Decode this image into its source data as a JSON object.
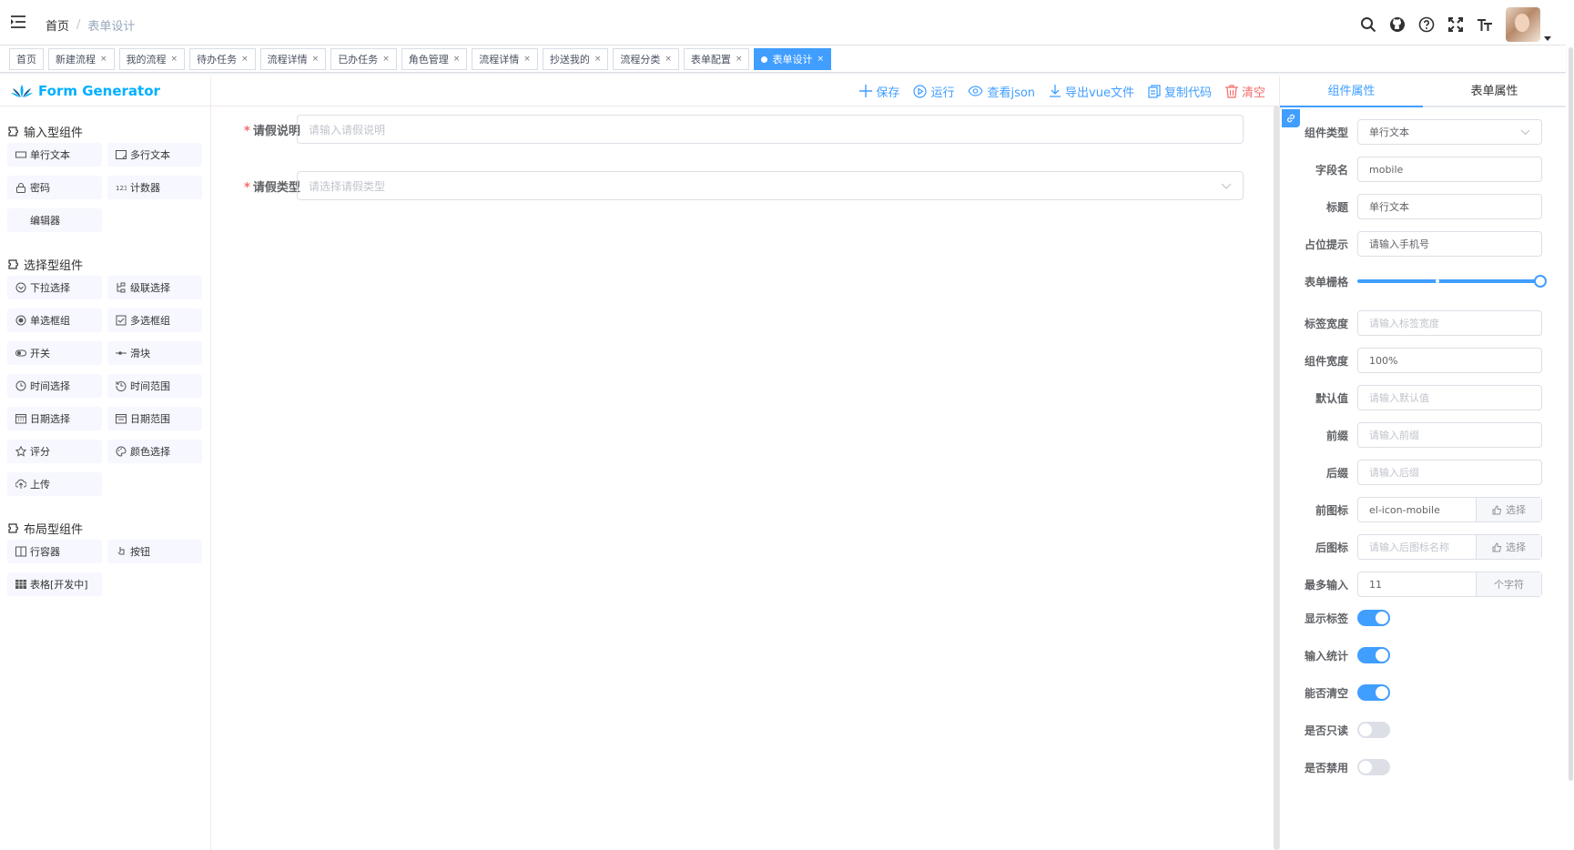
{
  "breadcrumb": {
    "home": "首页",
    "separator": "/",
    "current": "表单设计"
  },
  "tags": [
    {
      "label": "首页",
      "closable": false
    },
    {
      "label": "新建流程",
      "closable": true
    },
    {
      "label": "我的流程",
      "closable": true
    },
    {
      "label": "待办任务",
      "closable": true
    },
    {
      "label": "流程详情",
      "closable": true
    },
    {
      "label": "已办任务",
      "closable": true
    },
    {
      "label": "角色管理",
      "closable": true
    },
    {
      "label": "流程详情",
      "closable": true
    },
    {
      "label": "抄送我的",
      "closable": true
    },
    {
      "label": "流程分类",
      "closable": true
    },
    {
      "label": "表单配置",
      "closable": true
    },
    {
      "label": "表单设计",
      "closable": true,
      "active": true
    }
  ],
  "tag_close": "×",
  "logo": {
    "text": "Form Generator"
  },
  "categories": {
    "input": "输入型组件",
    "select": "选择型组件",
    "layout": "布局型组件"
  },
  "components": {
    "input": [
      {
        "label": "单行文本",
        "icon": "input-icon"
      },
      {
        "label": "多行文本",
        "icon": "textarea-icon"
      },
      {
        "label": "密码",
        "icon": "lock-icon"
      },
      {
        "label": "计数器",
        "icon": "number-icon"
      },
      {
        "label": "编辑器",
        "icon": "editor-icon"
      }
    ],
    "select": [
      {
        "label": "下拉选择",
        "icon": "select-icon"
      },
      {
        "label": "级联选择",
        "icon": "cascader-icon"
      },
      {
        "label": "单选框组",
        "icon": "radio-icon"
      },
      {
        "label": "多选框组",
        "icon": "checkbox-icon"
      },
      {
        "label": "开关",
        "icon": "switch-icon"
      },
      {
        "label": "滑块",
        "icon": "slider-icon"
      },
      {
        "label": "时间选择",
        "icon": "clock-icon"
      },
      {
        "label": "时间范围",
        "icon": "time-range-icon"
      },
      {
        "label": "日期选择",
        "icon": "date-icon"
      },
      {
        "label": "日期范围",
        "icon": "date-range-icon"
      },
      {
        "label": "评分",
        "icon": "star-icon"
      },
      {
        "label": "颜色选择",
        "icon": "palette-icon"
      },
      {
        "label": "上传",
        "icon": "upload-icon"
      }
    ],
    "layout": [
      {
        "label": "行容器",
        "icon": "row-icon"
      },
      {
        "label": "按钮",
        "icon": "button-icon"
      },
      {
        "label": "表格[开发中]",
        "icon": "table-icon"
      }
    ]
  },
  "toolbar": {
    "save": "保存",
    "run": "运行",
    "view_json": "查看json",
    "export_vue": "导出vue文件",
    "copy_code": "复制代码",
    "clear": "清空"
  },
  "form": {
    "fields": [
      {
        "label": "请假说明",
        "required": true,
        "placeholder": "请输入请假说明",
        "type": "input"
      },
      {
        "label": "请假类型",
        "required": true,
        "placeholder": "请选择请假类型",
        "type": "select"
      }
    ]
  },
  "right_tabs": {
    "component_props": "组件属性",
    "form_props": "表单属性"
  },
  "props": {
    "type": {
      "label": "组件类型",
      "value": "单行文本"
    },
    "field": {
      "label": "字段名",
      "value": "mobile"
    },
    "title": {
      "label": "标题",
      "value": "单行文本"
    },
    "placeholder": {
      "label": "占位提示",
      "value": "请输入手机号"
    },
    "span": {
      "label": "表单栅格",
      "value": 24,
      "max": 24
    },
    "label_width": {
      "label": "标签宽度",
      "placeholder": "请输入标签宽度"
    },
    "width": {
      "label": "组件宽度",
      "value": "100%"
    },
    "default": {
      "label": "默认值",
      "placeholder": "请输入默认值"
    },
    "prefix": {
      "label": "前缀",
      "placeholder": "请输入前缀"
    },
    "suffix": {
      "label": "后缀",
      "placeholder": "请输入后缀"
    },
    "prefix_icon": {
      "label": "前图标",
      "value": "el-icon-mobile",
      "button": "选择"
    },
    "suffix_icon": {
      "label": "后图标",
      "placeholder": "请输入后图标名称",
      "button": "选择"
    },
    "maxlength": {
      "label": "最多输入",
      "value": "11",
      "append": "个字符"
    },
    "show_label": {
      "label": "显示标签",
      "on": true
    },
    "word_limit": {
      "label": "输入统计",
      "on": true
    },
    "clearable": {
      "label": "能否清空",
      "on": true
    },
    "readonly": {
      "label": "是否只读",
      "on": false
    },
    "disabled": {
      "label": "是否禁用",
      "on": false
    }
  },
  "colors": {
    "primary": "#409eff",
    "danger": "#f56c6c",
    "logo": "#00afff"
  }
}
